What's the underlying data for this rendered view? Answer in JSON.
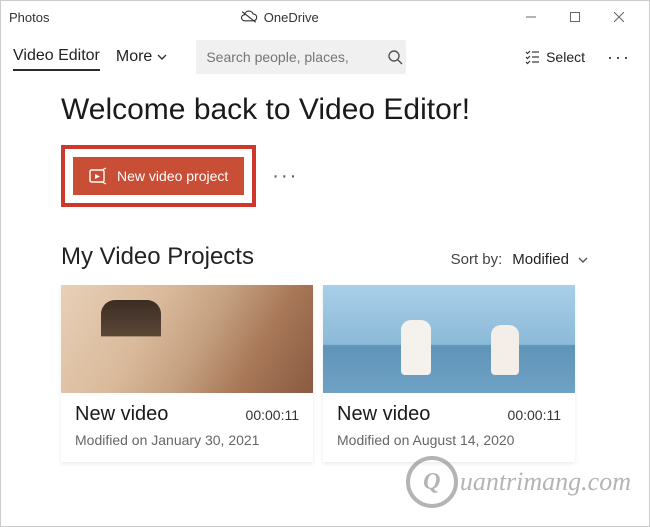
{
  "titlebar": {
    "app": "Photos",
    "cloud": "OneDrive"
  },
  "toolbar": {
    "tab_video_editor": "Video Editor",
    "more": "More",
    "search_placeholder": "Search people, places,",
    "select": "Select"
  },
  "main": {
    "welcome": "Welcome back to Video Editor!",
    "new_project": "New video project",
    "projects_heading": "My Video Projects",
    "sort_label": "Sort by:",
    "sort_value": "Modified"
  },
  "projects": [
    {
      "title": "New video",
      "duration": "00:00:11",
      "modified": "Modified on January 30, 2021"
    },
    {
      "title": "New video",
      "duration": "00:00:11",
      "modified": "Modified on August 14, 2020"
    }
  ],
  "watermark": {
    "letter": "Q",
    "text": "uantrimang.com"
  }
}
